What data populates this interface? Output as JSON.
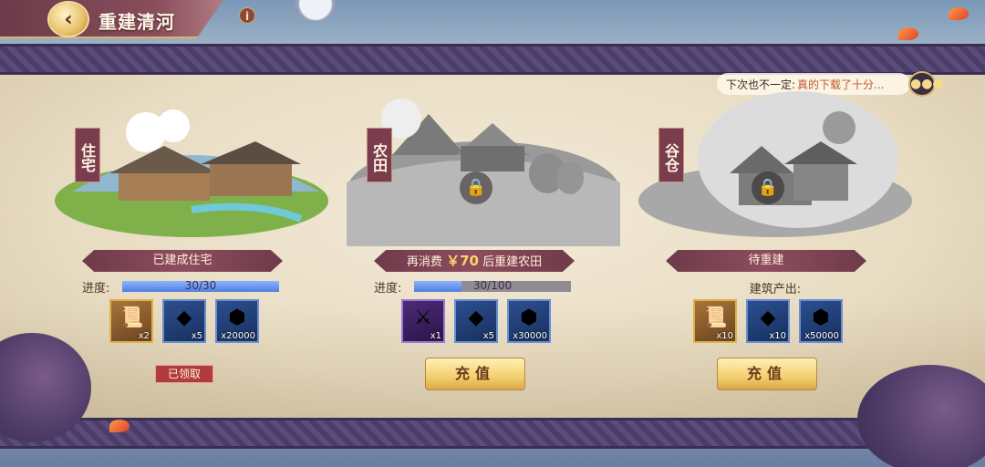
{
  "header": {
    "back_icon": "back-arrow-icon",
    "title": "重建清河",
    "info_icon": "i"
  },
  "chat": {
    "user": "下次也不一定:",
    "message": "真的下载了十分...",
    "icon": "chat-bubble-icon"
  },
  "cards": [
    {
      "label": "住宅",
      "status_text": "已建成住宅",
      "progress_label": "进度:",
      "progress_text": "30/30",
      "progress_fraction": 1.0,
      "rewards": [
        {
          "icon": "scroll-icon",
          "count": "x2"
        },
        {
          "icon": "jade-icon",
          "count": "x5"
        },
        {
          "icon": "silver-coin-icon",
          "count": "x20000"
        }
      ],
      "action_label": "已领取"
    },
    {
      "label": "农田",
      "status_prefix": "再消费",
      "status_cost": "￥70",
      "status_suffix": "后重建农田",
      "progress_label": "进度:",
      "progress_text": "30/100",
      "progress_fraction": 0.3,
      "rewards": [
        {
          "icon": "weapon-icon",
          "count": "x1"
        },
        {
          "icon": "jade-icon",
          "count": "x5"
        },
        {
          "icon": "silver-coin-icon",
          "count": "x30000"
        }
      ],
      "action_label": "充值"
    },
    {
      "label": "谷仓",
      "status_text": "待重建",
      "output_label": "建筑产出:",
      "rewards": [
        {
          "icon": "scroll-icon",
          "count": "x10"
        },
        {
          "icon": "jade-icon",
          "count": "x10"
        },
        {
          "icon": "silver-coin-icon",
          "count": "x50000"
        }
      ],
      "action_label": "充值"
    }
  ],
  "colors": {
    "accent_gold": "#f3cf6e",
    "banner": "#7a3d4e",
    "progress": "#4d7fe0"
  }
}
